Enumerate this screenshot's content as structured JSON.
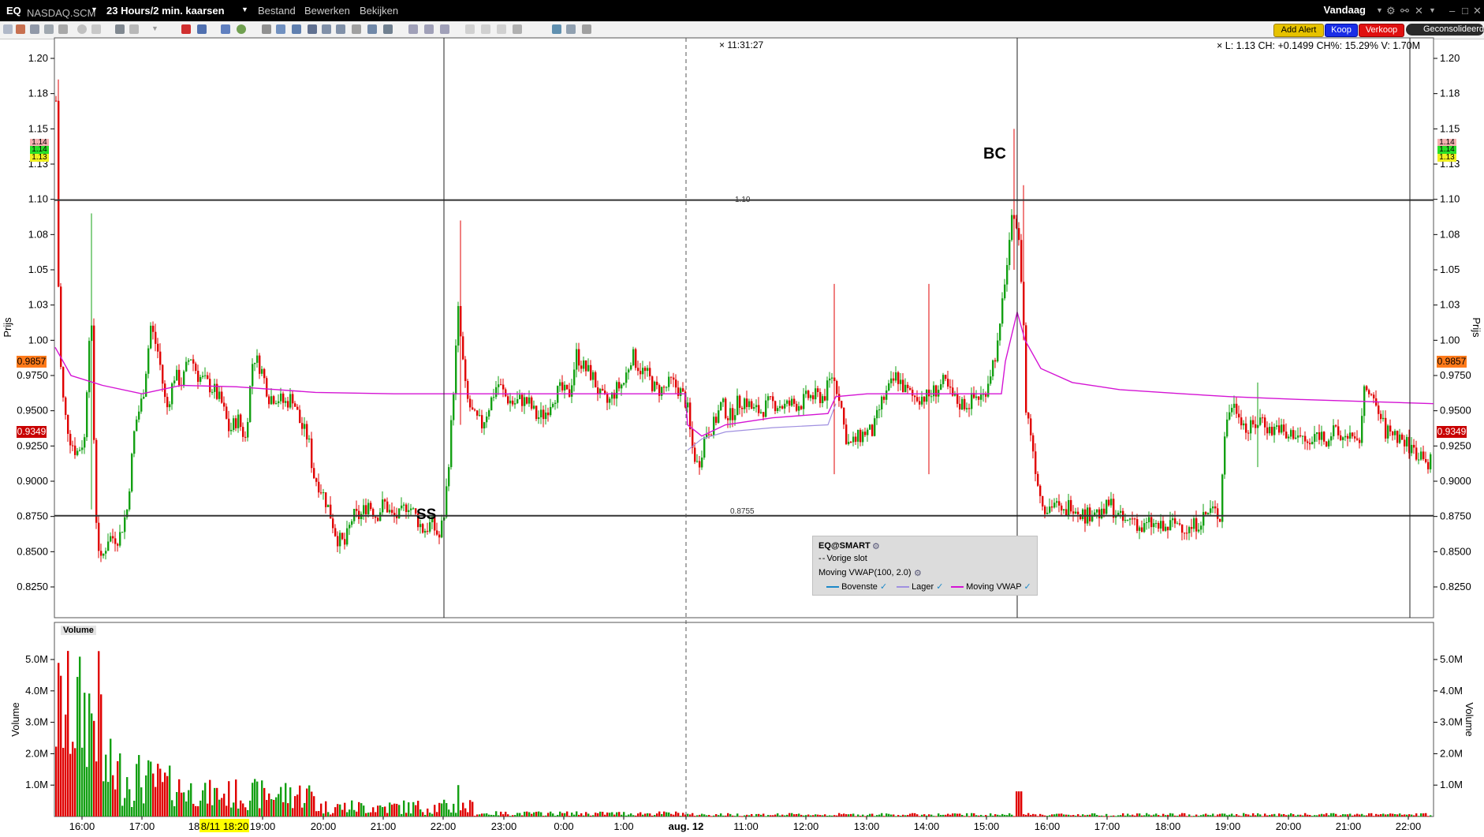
{
  "titlebar": {
    "symbol": "EQ",
    "exchange": "NASDAQ.SCM",
    "period": "23 Hours/2 min. kaarsen",
    "menus": [
      "Bestand",
      "Bewerken",
      "Bekijken"
    ],
    "today": "Vandaag"
  },
  "toolbar": {
    "add_alert": "Add Alert",
    "buy": "Koop",
    "sell": "Verkoop",
    "consolidated": "Geconsolideerd"
  },
  "chart": {
    "time_label": "11:31:27",
    "info": "L: 1.13 CH: +0.1499 CH%: 15.29% V: 1.70M",
    "price_axis_title": "Prijs",
    "volume_axis_title": "Volume",
    "volume_panel_title": "Volume",
    "price_ticks": [
      "1.20",
      "1.18",
      "1.15",
      "1.13",
      "1.10",
      "1.08",
      "1.05",
      "1.03",
      "1.00",
      "0.9750",
      "0.9500",
      "0.9250",
      "0.9000",
      "0.8750",
      "0.8500",
      "0.8250"
    ],
    "price_tick_values": [
      1.2,
      1.175,
      1.15,
      1.125,
      1.1,
      1.075,
      1.05,
      1.025,
      1.0,
      0.975,
      0.95,
      0.925,
      0.9,
      0.875,
      0.85,
      0.825
    ],
    "volume_ticks": [
      "5.0M",
      "4.0M",
      "3.0M",
      "2.0M",
      "1.0M"
    ],
    "volume_tick_values": [
      5,
      4,
      3,
      2,
      1
    ],
    "x_ticks": [
      "16:00",
      "17:00",
      "19:00",
      "20:00",
      "21:00",
      "22:00",
      "23:00",
      "0:00",
      "1:00",
      "aug. 12",
      "11:00",
      "12:00",
      "13:00",
      "14:00",
      "15:00",
      "16:00",
      "17:00",
      "18:00",
      "19:00",
      "20:00",
      "21:00",
      "22:00"
    ],
    "crosshair_date": "8/11 18:20",
    "cross_label_18": "18",
    "hline_upper_label": "1.10",
    "hline_lower_label": "0.8755",
    "marker_ss": "SS",
    "marker_bc": "BC",
    "badge_last": "0.9857",
    "badge_low": "0.9349",
    "badge_top_pink": "1.14",
    "badge_top_green": "1.14",
    "badge_top_yellow": "1.13"
  },
  "legend": {
    "title": "EQ@SMART",
    "prev_close": "Vorige slot",
    "indicator": "Moving VWAP(100, 2.0)",
    "items": [
      "Bovenste",
      "Lager",
      "Moving VWAP"
    ]
  },
  "chart_data": {
    "type": "candlestick",
    "hlines": [
      1.1,
      0.8755
    ],
    "y_price_range": [
      0.81,
      1.21
    ],
    "y_volume_range": [
      0,
      6
    ],
    "vwap_values": [
      0.995,
      0.97,
      0.962,
      0.966,
      0.968,
      0.966,
      0.963,
      0.962,
      0.962,
      0.962,
      0.962,
      0.94,
      0.945,
      0.948,
      0.95,
      0.96,
      0.962,
      0.962,
      1.02,
      0.98,
      0.965,
      0.96,
      0.957,
      0.955
    ],
    "colors": {
      "up": "#13a013",
      "down": "#e00000",
      "vwap": "#d414d4",
      "lower_band": "#a090e0",
      "upper_band": "#1c88c8"
    }
  }
}
